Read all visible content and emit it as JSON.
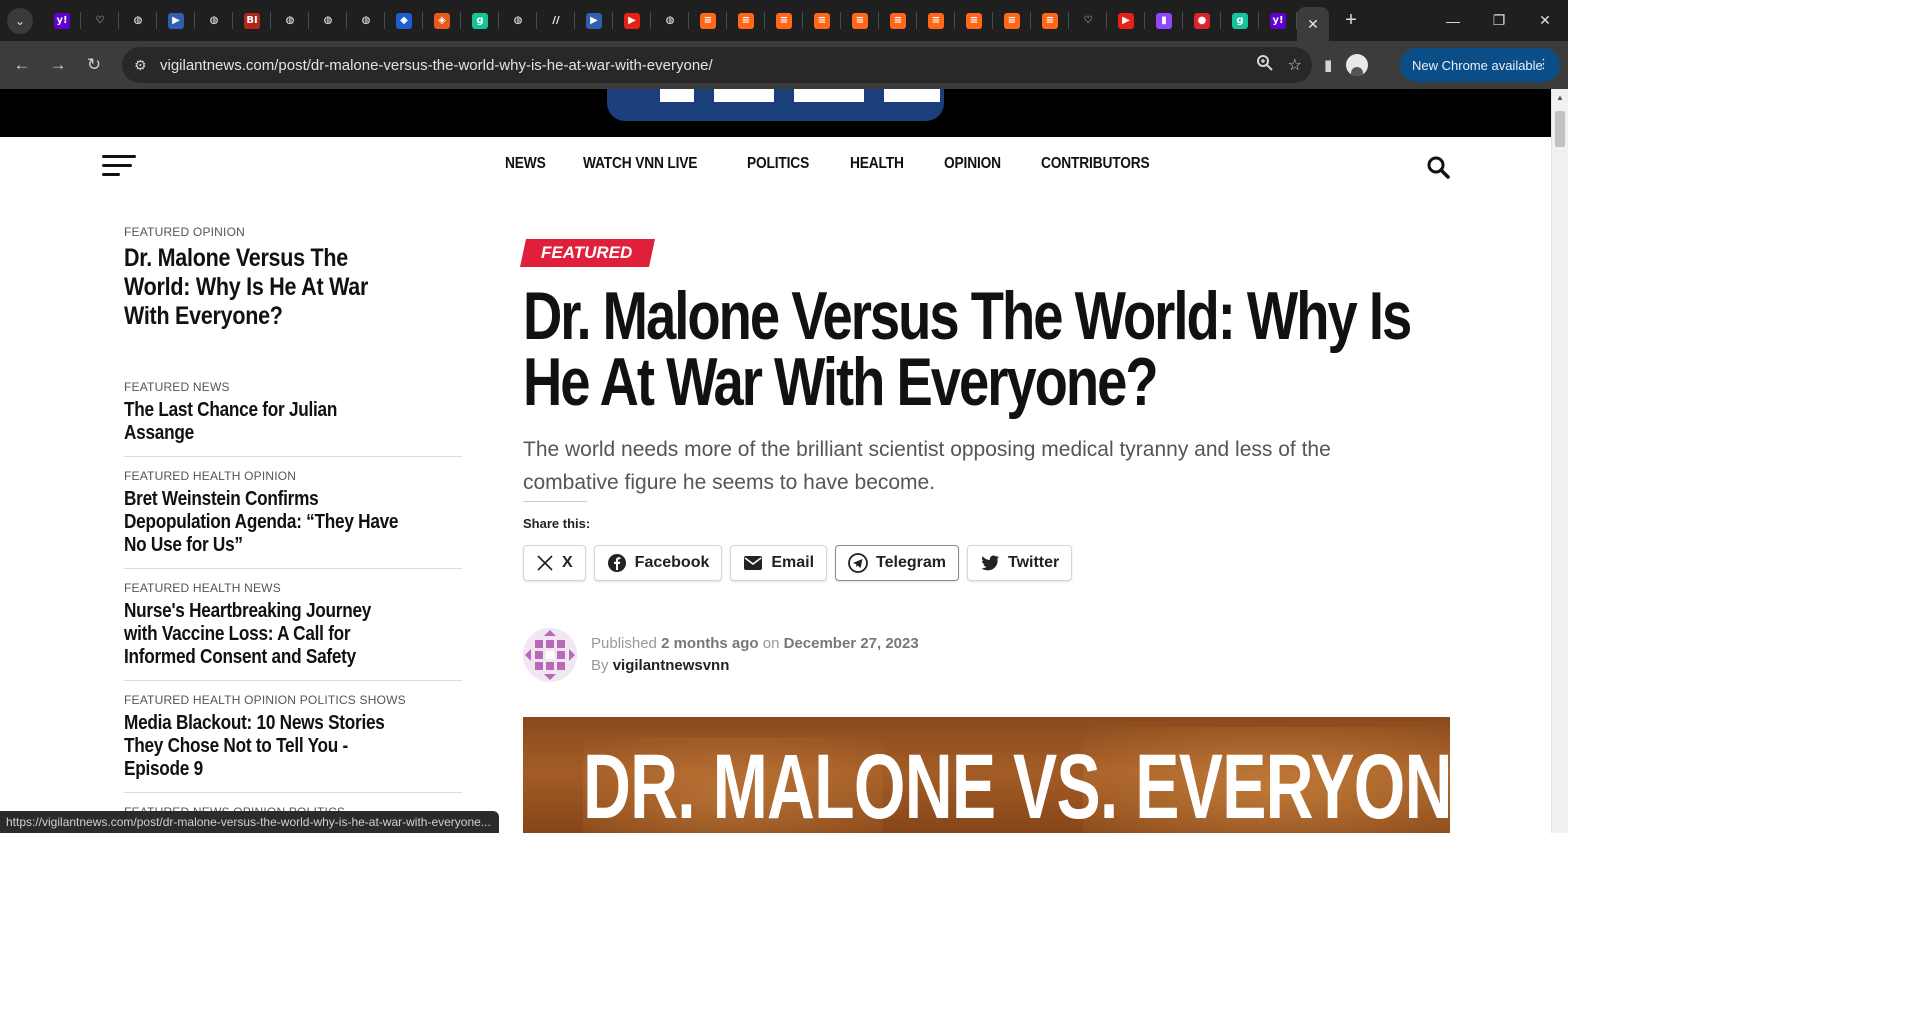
{
  "browser": {
    "url": "vigilantnews.com/post/dr-malone-versus-the-world-why-is-he-at-war-with-everyone/",
    "update_label": "New Chrome available",
    "status_url": "https://vigilantnews.com/post/dr-malone-versus-the-world-why-is-he-at-war-with-everyone...",
    "tabs": [
      {
        "icon": "yahoo-icon",
        "glyph": "y!",
        "color": "#6001d2"
      },
      {
        "icon": "shield-icon",
        "glyph": "♡",
        "color": "#1f1f1f"
      },
      {
        "icon": "globe-icon",
        "glyph": "◍",
        "color": "#1f1f1f"
      },
      {
        "icon": "bookmark-icon",
        "glyph": "▶",
        "color": "#2e5fb0"
      },
      {
        "icon": "globe-icon",
        "glyph": "◍",
        "color": "#1f1f1f"
      },
      {
        "icon": "business-insider-icon",
        "glyph": "BI",
        "color": "#b3261e"
      },
      {
        "icon": "globe-icon",
        "glyph": "◍",
        "color": "#1f1f1f"
      },
      {
        "icon": "globe-icon",
        "glyph": "◍",
        "color": "#1f1f1f"
      },
      {
        "icon": "globe-icon",
        "glyph": "◍",
        "color": "#1f1f1f"
      },
      {
        "icon": "cube-icon",
        "glyph": "◆",
        "color": "#1e5fd0"
      },
      {
        "icon": "brave-icon",
        "glyph": "◈",
        "color": "#e8591a"
      },
      {
        "icon": "grammarly-icon",
        "glyph": "g",
        "color": "#15c39a"
      },
      {
        "icon": "globe-icon",
        "glyph": "◍",
        "color": "#1f1f1f"
      },
      {
        "icon": "slash-icon",
        "glyph": "//",
        "color": "#1f1f1f"
      },
      {
        "icon": "bookmark-icon",
        "glyph": "▶",
        "color": "#2e5fb0"
      },
      {
        "icon": "youtube-icon",
        "glyph": "▶",
        "color": "#e62117"
      },
      {
        "icon": "globe-icon",
        "glyph": "◍",
        "color": "#1f1f1f"
      },
      {
        "icon": "substack-icon",
        "glyph": "≡",
        "color": "#ff6719"
      },
      {
        "icon": "substack-icon",
        "glyph": "≡",
        "color": "#ff6719"
      },
      {
        "icon": "substack-icon",
        "glyph": "≡",
        "color": "#ff6719"
      },
      {
        "icon": "substack-icon",
        "glyph": "≡",
        "color": "#ff6719"
      },
      {
        "icon": "substack-icon",
        "glyph": "≡",
        "color": "#ff6719"
      },
      {
        "icon": "substack-icon",
        "glyph": "≡",
        "color": "#ff6719"
      },
      {
        "icon": "substack-icon",
        "glyph": "≡",
        "color": "#ff6719"
      },
      {
        "icon": "substack-icon",
        "glyph": "≡",
        "color": "#ff6719"
      },
      {
        "icon": "substack-icon",
        "glyph": "≡",
        "color": "#ff6719"
      },
      {
        "icon": "substack-icon",
        "glyph": "≡",
        "color": "#ff6719"
      },
      {
        "icon": "shield-icon",
        "glyph": "♡",
        "color": "#1f1f1f"
      },
      {
        "icon": "youtube-icon",
        "glyph": "▶",
        "color": "#e62117"
      },
      {
        "icon": "twitch-icon",
        "glyph": "▮",
        "color": "#9146ff"
      },
      {
        "icon": "mic-icon",
        "glyph": "●",
        "color": "#d9232f"
      },
      {
        "icon": "grammarly-icon",
        "glyph": "g",
        "color": "#15c39a"
      },
      {
        "icon": "yahoo-icon",
        "glyph": "y!",
        "color": "#6001d2"
      }
    ]
  },
  "site": {
    "nav": [
      "NEWS",
      "WATCH VNN LIVE",
      "POLITICS",
      "HEALTH",
      "OPINION",
      "CONTRIBUTORS"
    ],
    "accent": "#e0203a"
  },
  "sidebar": {
    "items": [
      {
        "category": "FEATURED OPINION",
        "title": "Dr. Malone Versus The World: Why Is He At War With Everyone?"
      },
      {
        "category": "FEATURED NEWS",
        "title": "The Last Chance for Julian Assange"
      },
      {
        "category": "FEATURED HEALTH OPINION",
        "title": "Bret Weinstein Confirms Depopulation Agenda: “They Have No Use for Us”"
      },
      {
        "category": "FEATURED HEALTH NEWS",
        "title": "Nurse's Heartbreaking Journey with Vaccine Loss: A Call for Informed Consent and Safety"
      },
      {
        "category": "FEATURED HEALTH OPINION POLITICS SHOWS",
        "title": "Media Blackout: 10 News Stories They Chose Not to Tell You - Episode 9"
      },
      {
        "category": "FEATURED NEWS OPINION POLITICS",
        "title": ""
      }
    ]
  },
  "article": {
    "badge": "FEATURED",
    "headline": "Dr. Malone Versus The World: Why Is He At War With Everyone?",
    "dek": "The world needs more of the brilliant scientist opposing medical tyranny and less of the combative figure he seems to have become.",
    "share_label": "Share this:",
    "share_buttons": [
      {
        "label": "X",
        "icon": "x-icon"
      },
      {
        "label": "Facebook",
        "icon": "facebook-icon"
      },
      {
        "label": "Email",
        "icon": "email-icon"
      },
      {
        "label": "Telegram",
        "icon": "telegram-icon"
      },
      {
        "label": "Twitter",
        "icon": "twitter-icon"
      }
    ],
    "published_prefix": "Published",
    "published_ago": "2 months ago",
    "published_on": "on",
    "published_date": "December 27, 2023",
    "by_prefix": "By",
    "author": "vigilantnewsvnn",
    "hero_text": "DR. MALONE VS. EVERYONE"
  }
}
